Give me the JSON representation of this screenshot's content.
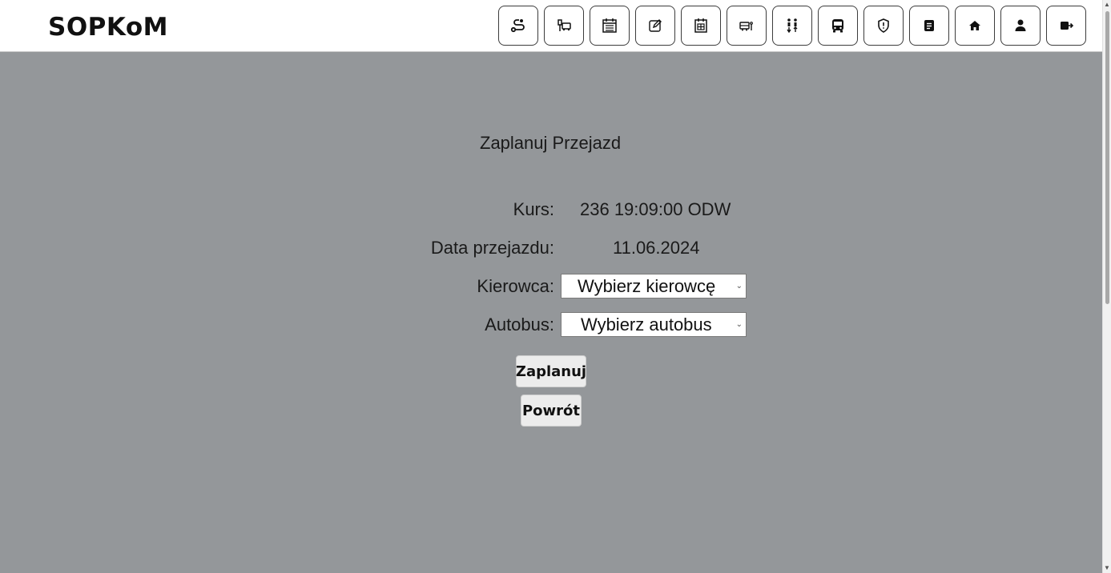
{
  "header": {
    "logo": "SOPKoM",
    "nav_icons": [
      "route-icon",
      "bus-stop-icon",
      "timetable-icon",
      "edit-icon",
      "schedule-icon",
      "bus-station-icon",
      "passengers-icon",
      "bus-icon",
      "shield-icon",
      "document-icon",
      "home-icon",
      "user-icon",
      "logout-icon"
    ]
  },
  "page": {
    "title": "Zaplanuj Przejazd",
    "course_label": "Kurs:",
    "course_value": "236 19:09:00 ODW",
    "date_label": "Data przejazdu:",
    "date_value": "11.06.2024",
    "driver_label": "Kierowca:",
    "driver_select": "Wybierz kierowcę",
    "bus_label": "Autobus:",
    "bus_select": "Wybierz autobus",
    "plan_button": "Zaplanuj",
    "back_button": "Powrót"
  },
  "colors": {
    "background": "#94979a",
    "header": "#ffffff",
    "button": "#ececec"
  }
}
